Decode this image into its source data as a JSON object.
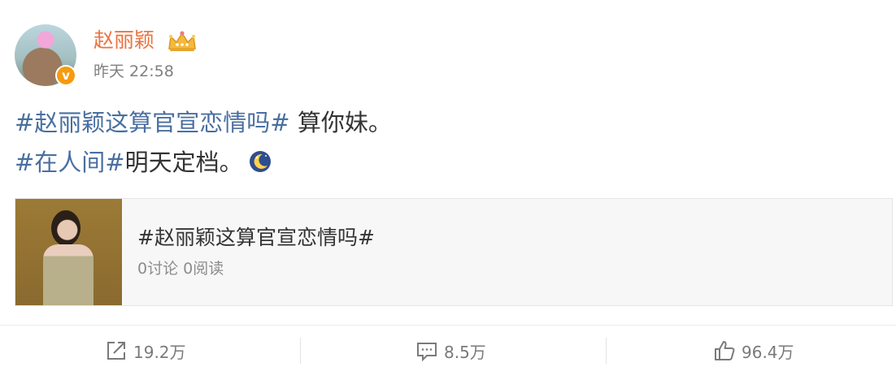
{
  "post": {
    "author": {
      "name": "赵丽颖",
      "verified_symbol": "v",
      "vip_icon": "crown-icon"
    },
    "timestamp": "昨天 22:58",
    "content": {
      "line1_tag": "#赵丽颖这算官宣恋情吗#",
      "line1_text": " 算你妹。",
      "line2_tag": "#在人间#",
      "line2_text": "明天定档。",
      "emoji": "moon-icon"
    },
    "topic_card": {
      "title": "#赵丽颖这算官宣恋情吗#",
      "meta": "0讨论 0阅读"
    }
  },
  "actions": {
    "repost": {
      "icon": "share-icon",
      "count": "19.2万"
    },
    "comment": {
      "icon": "comment-icon",
      "count": "8.5万"
    },
    "like": {
      "icon": "thumbs-up-icon",
      "count": "96.4万"
    }
  },
  "colors": {
    "username": "#eb7340",
    "hashtag": "#4a6fa0",
    "badge": "#f59b0f",
    "meta_text": "#808080"
  }
}
